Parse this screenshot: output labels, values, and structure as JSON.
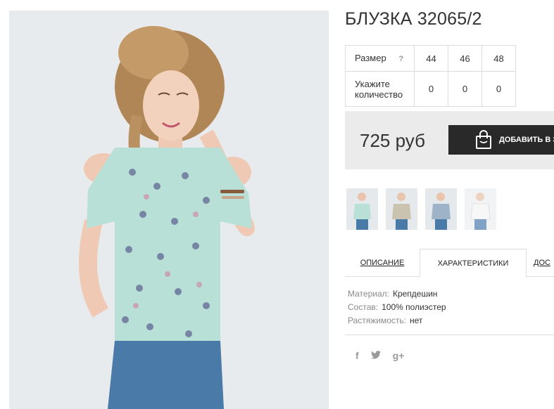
{
  "product": {
    "title": "БЛУЗКА 32065/2"
  },
  "size_table": {
    "size_label": "Размер",
    "help_icon_text": "?",
    "sizes": [
      "44",
      "46",
      "48"
    ],
    "quantity_label_line1": "Укажите",
    "quantity_label_line2": "количество",
    "quantities": [
      "0",
      "0",
      "0"
    ]
  },
  "purchase": {
    "price": "725 руб",
    "add_button_label": "ДОБАВИТЬ В З",
    "bag_icon": "shopping-bag-icon"
  },
  "gallery": {
    "thumbnails": [
      "photo-front",
      "photo-side",
      "photo-pose",
      "photo-white"
    ]
  },
  "tabs": {
    "description": "ОПИСАНИЕ",
    "characteristics": "ХАРАКТЕРИСТИКИ",
    "delivery": "ДОС",
    "active": "characteristics"
  },
  "specs": [
    {
      "key": "Материал:",
      "value": "Крепдешин"
    },
    {
      "key": "Состав:",
      "value": "100% полиэстер"
    },
    {
      "key": "Растяжимость:",
      "value": "нет"
    }
  ],
  "social": {
    "facebook": "f",
    "twitter_icon": "twitter-icon",
    "googleplus": "g+"
  },
  "colors": {
    "button_bg": "#292929",
    "price_box_bg": "#ebebeb",
    "blouse": "#b9e0d6",
    "jeans": "#4a7aa8"
  }
}
